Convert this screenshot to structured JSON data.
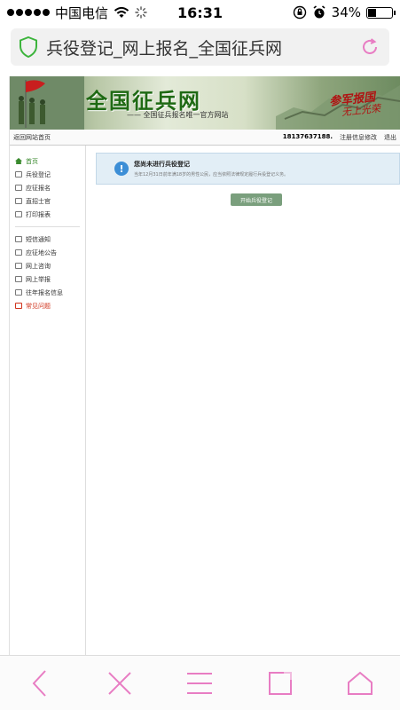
{
  "status_bar": {
    "carrier": "中国电信",
    "time": "16:31",
    "battery": "34%",
    "battery_level": 0.34
  },
  "browser": {
    "page_title": "兵役登记_网上报名_全国征兵网"
  },
  "banner": {
    "site_title": "全国征兵网",
    "slogan": "—— 全国征兵报名唯一官方网站",
    "motto_line1": "参军报国",
    "motto_line2": "无上光荣"
  },
  "topnav": {
    "back_label": "返回网站首页",
    "phone": "18137637188.",
    "edit_label": "注册信息修改",
    "logout_label": "退出"
  },
  "sidebar": {
    "group1": [
      {
        "label": "首页"
      },
      {
        "label": "兵役登记"
      },
      {
        "label": "应征报名"
      },
      {
        "label": "直招士官"
      },
      {
        "label": "打印报表"
      }
    ],
    "group2": [
      {
        "label": "短信通知"
      },
      {
        "label": "应征地公告"
      },
      {
        "label": "网上咨询"
      },
      {
        "label": "网上举报"
      },
      {
        "label": "往年报名信息"
      },
      {
        "label": "常见问题"
      }
    ]
  },
  "notice": {
    "heading": "您尚未进行兵役登记",
    "text": "当年12月31日前年满18岁的男性公民，应当依照法律规定履行兵役登记义务。"
  },
  "start_button": "开始兵役登记",
  "colors": {
    "accent_green": "#3a8a2e",
    "notice_bg": "#e2eef6",
    "button_green": "#7a9f7d",
    "toolbar_pink": "#e87dc3"
  }
}
